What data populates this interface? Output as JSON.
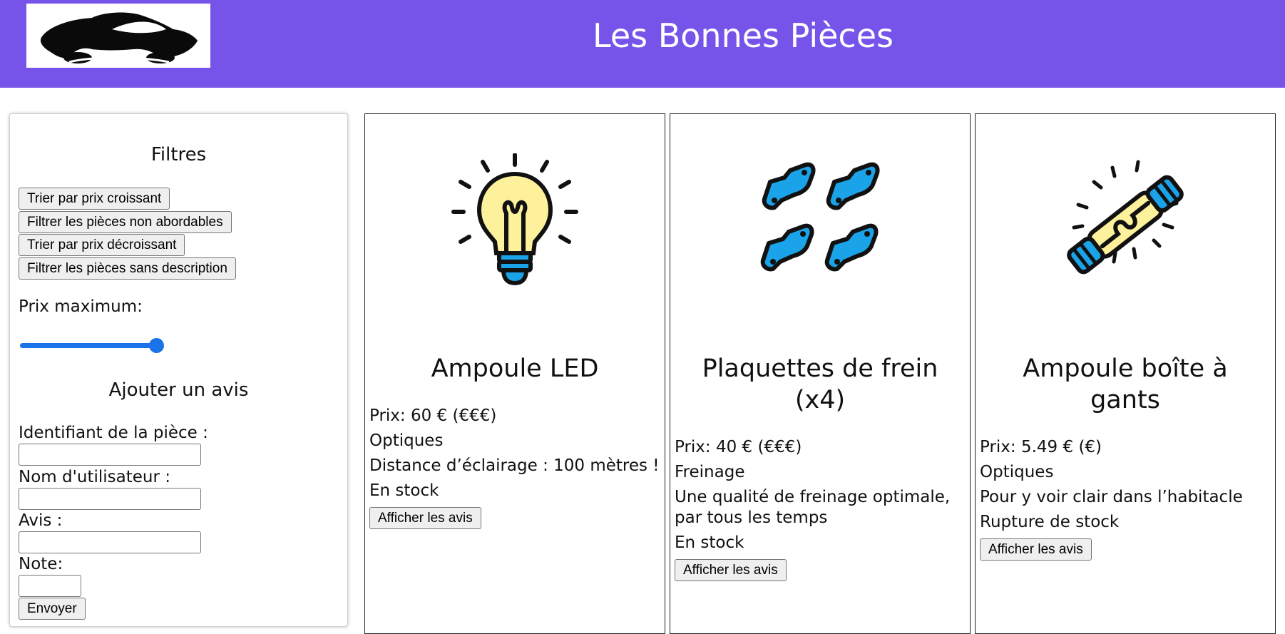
{
  "header": {
    "title": "Les Bonnes Pièces",
    "background": "#7654ea",
    "logo_icon": "car-silhouette-icon"
  },
  "filters": {
    "title": "Filtres",
    "buttons": [
      "Trier par prix croissant",
      "Filtrer les pièces non abordables",
      "Trier par prix décroissant",
      "Filtrer les pièces sans description"
    ],
    "max_price_label": "Prix maximum:",
    "review_title": "Ajouter un avis",
    "fields": [
      "Identifiant de la pièce :",
      "Nom d'utilisateur :",
      "Avis :",
      "Note:"
    ],
    "submit_label": "Envoyer",
    "slider_color": "#1a73e8"
  },
  "products": [
    {
      "name": "Ampoule LED",
      "price": "Prix: 60 € (€€€)",
      "category": "Optiques",
      "description": "Distance d’éclairage : 100 mètres !",
      "stock": "En stock",
      "button": "Afficher les avis",
      "icon": "light-bulb-icon"
    },
    {
      "name": "Plaquettes de frein (x4)",
      "price": "Prix: 40 € (€€€)",
      "category": "Freinage",
      "description": "Une qualité de freinage optimale, par tous les temps",
      "stock": "En stock",
      "button": "Afficher les avis",
      "icon": "brake-pads-icon"
    },
    {
      "name": "Ampoule boîte à gants",
      "price": "Prix: 5.49 € (€)",
      "category": "Optiques",
      "description": "Pour y voir clair dans l’habitacle",
      "stock": "Rupture de stock",
      "button": "Afficher les avis",
      "icon": "tube-bulb-icon"
    }
  ]
}
